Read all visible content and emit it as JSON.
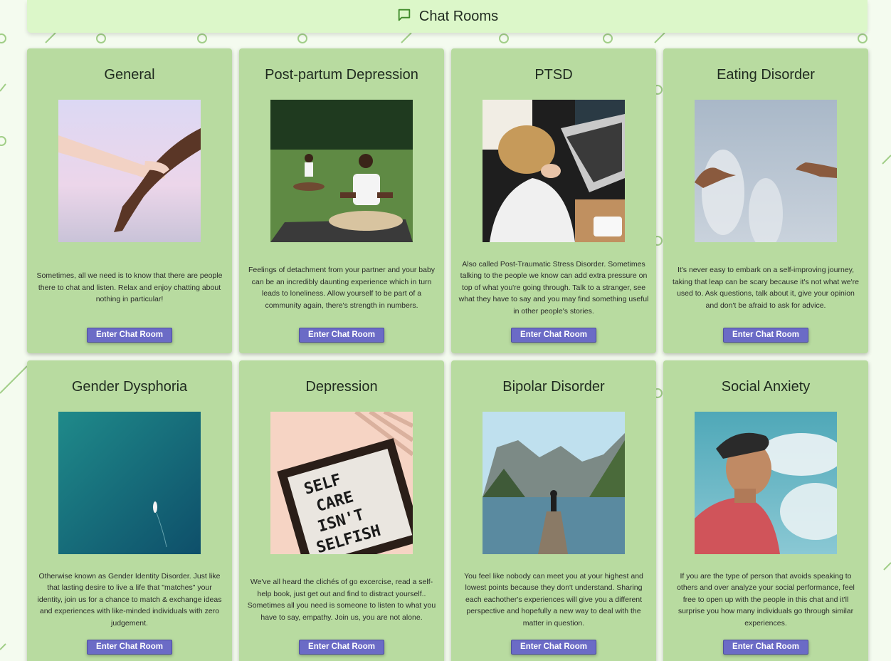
{
  "header": {
    "title": "Chat Rooms",
    "icon": "chat-bubble-icon"
  },
  "colors": {
    "accent": "#6b6bc6",
    "card": "#b8dba0",
    "header": "#dcf7c9",
    "background": "#f4fbef"
  },
  "rooms": [
    {
      "name": "General",
      "description": "Sometimes, all we need is to know that there are people there to chat and listen. Relax and enjoy chatting about nothing in particular!",
      "button": "Enter Chat Room",
      "image": "hands-holding-image"
    },
    {
      "name": "Post-partum Depression",
      "description": "Feelings of detachment from your partner and your baby can be an incredibly daunting experience which in turn leads to loneliness. Allow yourself to be part of a community again, there's strength in numbers.",
      "button": "Enter Chat Room",
      "image": "people-meditating-image"
    },
    {
      "name": "PTSD",
      "description": "Also called Post-Traumatic Stress Disorder. Sometimes talking to the people we know can add extra pressure on top of what you're going through. Talk to a stranger, see what they have to say and you may find something useful in other people's stories.",
      "button": "Enter Chat Room",
      "image": "stressed-person-desk-image"
    },
    {
      "name": "Eating Disorder",
      "description": "It's never easy to embark on a self-improving journey, taking that leap can be scary because it's not what we're used to. Ask questions, talk about it, give your opinion and don't be afraid to ask for advice.",
      "button": "Enter Chat Room",
      "image": "reaching-hands-sky-image"
    },
    {
      "name": "Gender Dysphoria",
      "description": "Otherwise known as Gender Identity Disorder. Just like that lasting desire to live a life that \"matches\" your identity, join us for a chance to match & exchange ideas and experiences with like-minded individuals with zero judgement.",
      "button": "Enter Chat Room",
      "image": "boat-on-ocean-image"
    },
    {
      "name": "Depression",
      "description": "We've all heard the clichés of go excercise, read a self-help book, just get out and find to distract yourself.. Sometimes all you need is someone to listen to what you have to say, empathy. Join us, you are not alone.",
      "button": "Enter Chat Room",
      "image": "self-care-letterboard-image",
      "image_text": [
        "SELF",
        "CARE",
        "ISN'T",
        "SELFISH"
      ]
    },
    {
      "name": "Bipolar Disorder",
      "description": "You feel like nobody can meet you at your highest and lowest points because they don't understand. Sharing each eachother's experiences will give you a different perspective and hopefully a new way to deal with the matter in question.",
      "button": "Enter Chat Room",
      "image": "lake-mountains-pier-image"
    },
    {
      "name": "Social Anxiety",
      "description": "If you are the type of person that avoids speaking to others and over analyze your social performance, feel free to open up with the people in this chat and it'll surprise you how many individuals go through similar experiences.",
      "button": "Enter Chat Room",
      "image": "man-looking-up-sky-image"
    }
  ]
}
